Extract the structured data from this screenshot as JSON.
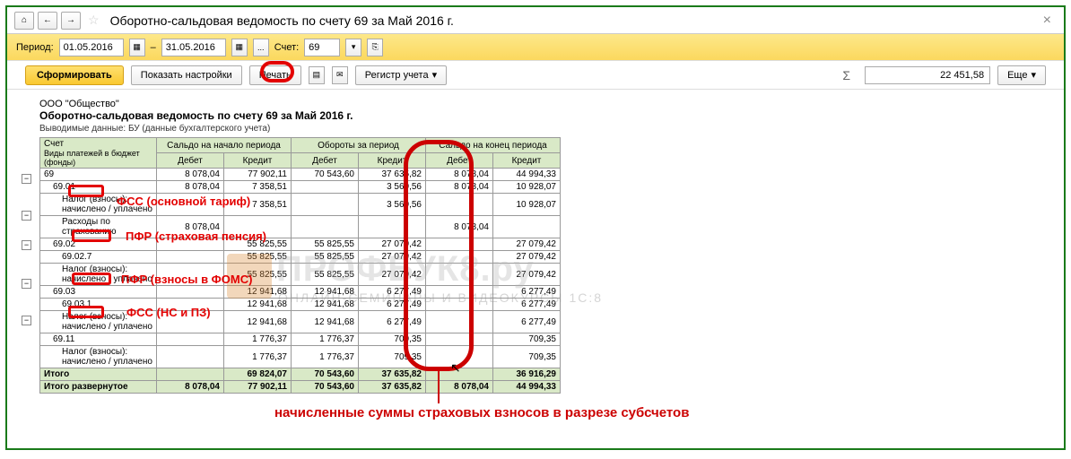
{
  "title": "Оборотно-сальдовая ведомость по счету 69 за Май 2016 г.",
  "toolbar1": {
    "period_label": "Период:",
    "date_from": "01.05.2016",
    "dash": "–",
    "date_to": "31.05.2016",
    "dots": "...",
    "account_label": "Счет:",
    "account_value": "69"
  },
  "toolbar2": {
    "format": "Сформировать",
    "settings": "Показать настройки",
    "print": "Печать",
    "register": "Регистр учета",
    "sigma": "Σ",
    "total": "22 451,58",
    "more": "Еще"
  },
  "report": {
    "org": "ООО \"Общество\"",
    "title": "Оборотно-сальдовая ведомость по счету 69 за Май 2016 г.",
    "sub": "Выводимые данные: БУ (данные бухгалтерского учета)",
    "hdr_acct": "Счет",
    "hdr_funds": "Виды платежей в бюджет (фонды)",
    "hdr_g1": "Сальдо на начало периода",
    "hdr_g2": "Обороты за период",
    "hdr_g3": "Сальдо на конец периода",
    "hdr_debit": "Дебет",
    "hdr_credit": "Кредит",
    "rows": [
      {
        "name": "69",
        "c0": "8 078,04",
        "c1": "77 902,11",
        "c2": "70 543,60",
        "c3": "37 635,82",
        "c4": "8 078,04",
        "c5": "44 994,33",
        "cls": ""
      },
      {
        "name": "69.01",
        "c0": "8 078,04",
        "c1": "7 358,51",
        "c2": "",
        "c3": "3 569,56",
        "c4": "8 078,04",
        "c5": "10 928,07",
        "cls": "row-sub"
      },
      {
        "name": "Налог (взносы): начислено / уплачено",
        "c0": "",
        "c1": "7 358,51",
        "c2": "",
        "c3": "3 569,56",
        "c4": "",
        "c5": "10 928,07",
        "cls": "row-sub2"
      },
      {
        "name": "Расходы по страхованию",
        "c0": "8 078,04",
        "c1": "",
        "c2": "",
        "c3": "",
        "c4": "8 078,04",
        "c5": "",
        "cls": "row-sub2"
      },
      {
        "name": "69.02",
        "c0": "",
        "c1": "55 825,55",
        "c2": "55 825,55",
        "c3": "27 079,42",
        "c4": "",
        "c5": "27 079,42",
        "cls": "row-sub"
      },
      {
        "name": "69.02.7",
        "c0": "",
        "c1": "55 825,55",
        "c2": "55 825,55",
        "c3": "27 079,42",
        "c4": "",
        "c5": "27 079,42",
        "cls": "row-sub2"
      },
      {
        "name": "Налог (взносы): начислено / уплачено",
        "c0": "",
        "c1": "55 825,55",
        "c2": "55 825,55",
        "c3": "27 079,42",
        "c4": "",
        "c5": "27 079,42",
        "cls": "row-sub2"
      },
      {
        "name": "69.03",
        "c0": "",
        "c1": "12 941,68",
        "c2": "12 941,68",
        "c3": "6 277,49",
        "c4": "",
        "c5": "6 277,49",
        "cls": "row-sub"
      },
      {
        "name": "69.03.1",
        "c0": "",
        "c1": "12 941,68",
        "c2": "12 941,68",
        "c3": "6 277,49",
        "c4": "",
        "c5": "6 277,49",
        "cls": "row-sub2"
      },
      {
        "name": "Налог (взносы): начислено / уплачено",
        "c0": "",
        "c1": "12 941,68",
        "c2": "12 941,68",
        "c3": "6 277,49",
        "c4": "",
        "c5": "6 277,49",
        "cls": "row-sub2"
      },
      {
        "name": "69.11",
        "c0": "",
        "c1": "1 776,37",
        "c2": "1 776,37",
        "c3": "709,35",
        "c4": "",
        "c5": "709,35",
        "cls": "row-sub"
      },
      {
        "name": "Налог (взносы): начислено / уплачено",
        "c0": "",
        "c1": "1 776,37",
        "c2": "1 776,37",
        "c3": "709,35",
        "c4": "",
        "c5": "709,35",
        "cls": "row-sub2"
      },
      {
        "name": "Итого",
        "c0": "",
        "c1": "69 824,07",
        "c2": "70 543,60",
        "c3": "37 635,82",
        "c4": "",
        "c5": "36 916,29",
        "cls": "row-total"
      },
      {
        "name": "Итого развернутое",
        "c0": "8 078,04",
        "c1": "77 902,11",
        "c2": "70 543,60",
        "c3": "37 635,82",
        "c4": "8 078,04",
        "c5": "44 994,33",
        "cls": "row-total"
      }
    ]
  },
  "annotations": {
    "a1": "ФСС (основной тариф)",
    "a2": "ПФР (страховая пенсия)",
    "a3": "ПФР (взносы в ФОМС)",
    "a4": "ФСС (НС и ПЗ)",
    "a5": "начисленные суммы страховых взносов в разрезе субсчетов"
  },
  "watermark": {
    "main": "ПРОФБУК8.ру",
    "sub": "ОНЛАЙН-СЕМИНАРЫ И ВИДЕОКУРСЫ 1С:8"
  }
}
